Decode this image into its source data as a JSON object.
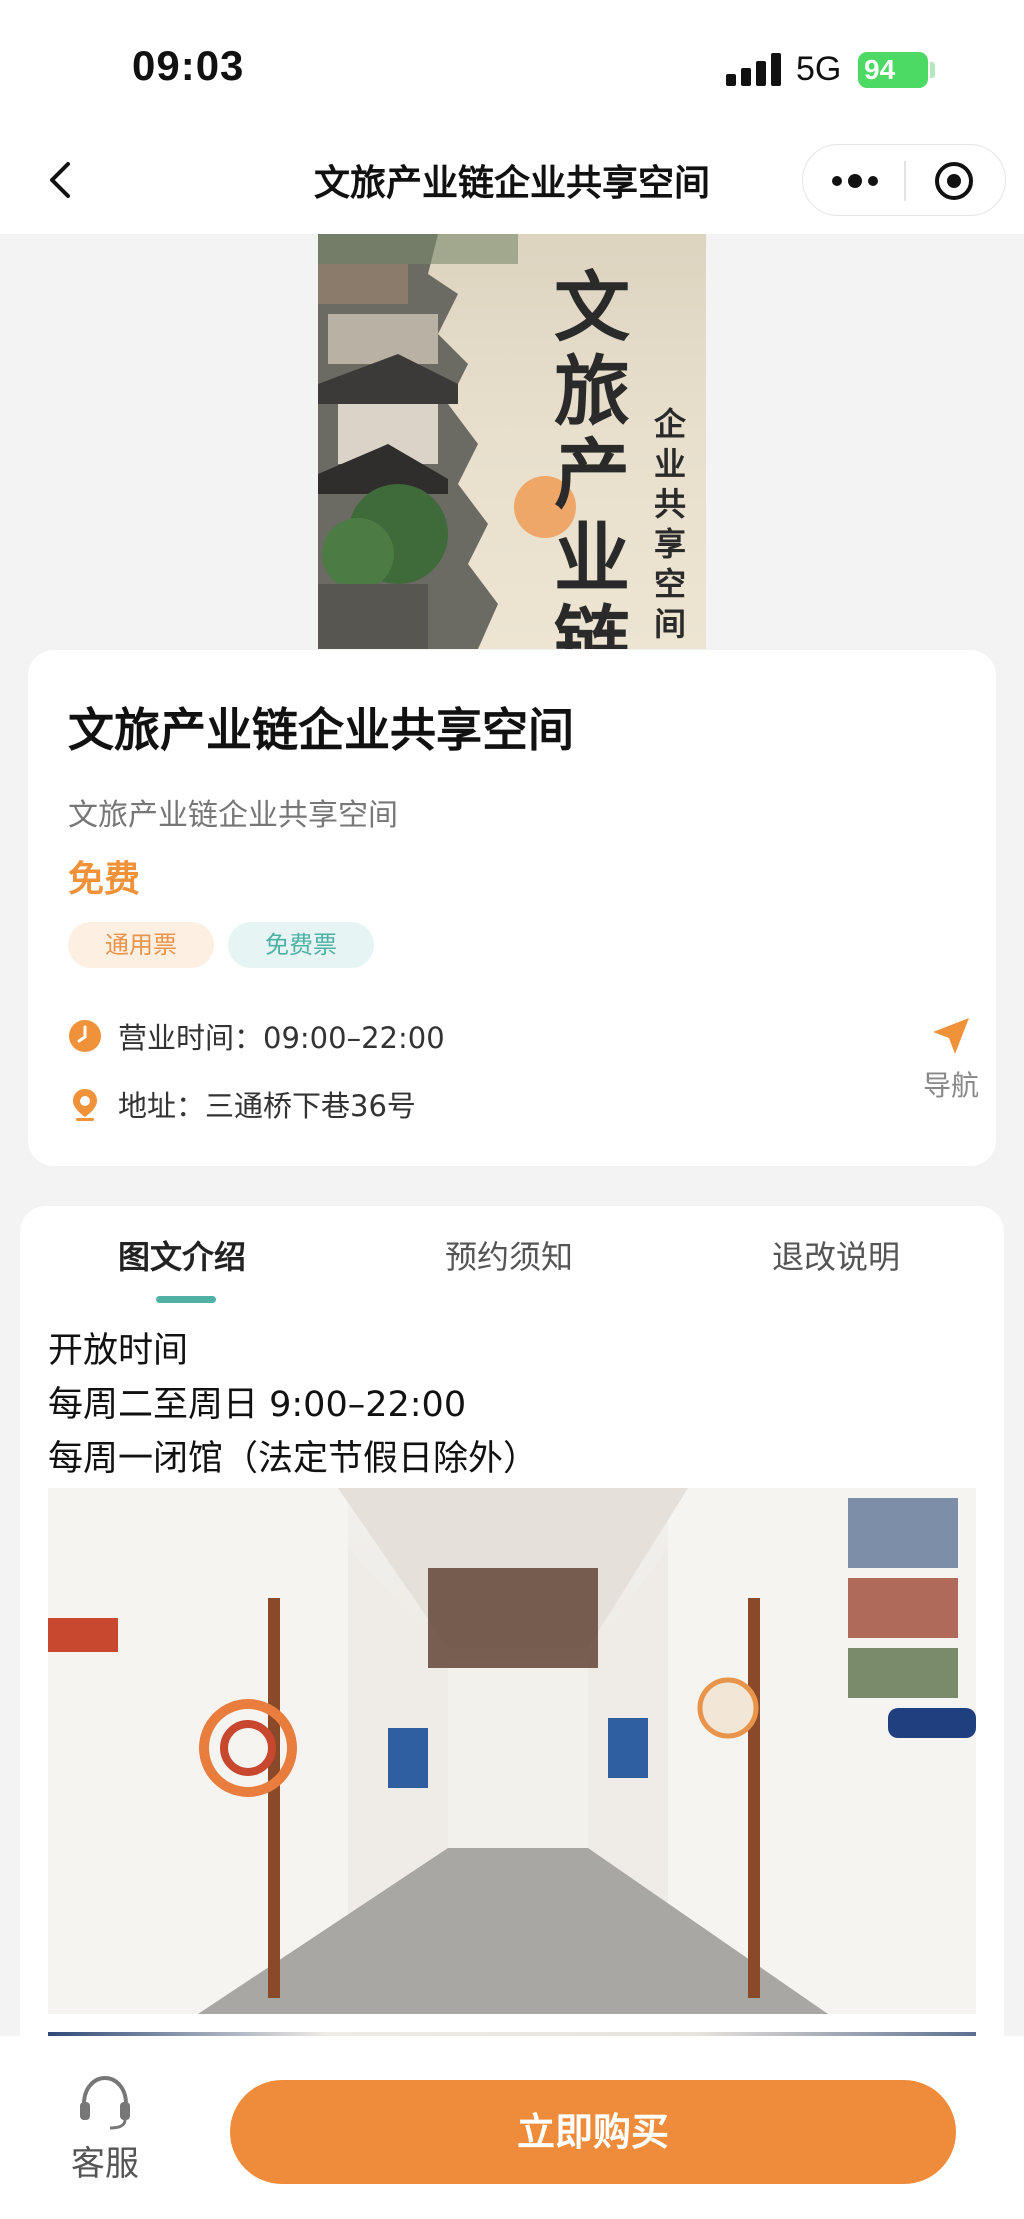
{
  "status_bar": {
    "time": "09:03",
    "network": "5G",
    "battery": "94"
  },
  "nav": {
    "title": "文旅产业链企业共享空间",
    "back_icon": "chevron-left-icon",
    "more_icon": "more-dots-icon",
    "close_icon": "target-close-icon"
  },
  "hero": {
    "main_text": [
      "文",
      "旅",
      "产",
      "业",
      "链"
    ],
    "sub_text": [
      "企",
      "业",
      "共",
      "享",
      "空",
      "间"
    ]
  },
  "info": {
    "title": "文旅产业链企业共享空间",
    "subtitle": "文旅产业链企业共享空间",
    "price": "免费",
    "tags": [
      "通用票",
      "免费票"
    ],
    "hours": "营业时间：09:00–22:00",
    "address": "地址：三通桥下巷36号",
    "navigate_label": "导航"
  },
  "tabs": [
    {
      "label": "图文介绍",
      "active": true
    },
    {
      "label": "预约须知",
      "active": false
    },
    {
      "label": "退改说明",
      "active": false
    }
  ],
  "description": [
    "开放时间",
    "每周二至周日 9:00–22:00",
    "每周一闭馆（法定节假日除外）"
  ],
  "bottom": {
    "service_label": "客服",
    "buy_label": "立即购买"
  },
  "colors": {
    "accent_orange": "#ef8c3b",
    "accent_teal": "#4fb1a6",
    "price_orange": "#f0923a"
  }
}
